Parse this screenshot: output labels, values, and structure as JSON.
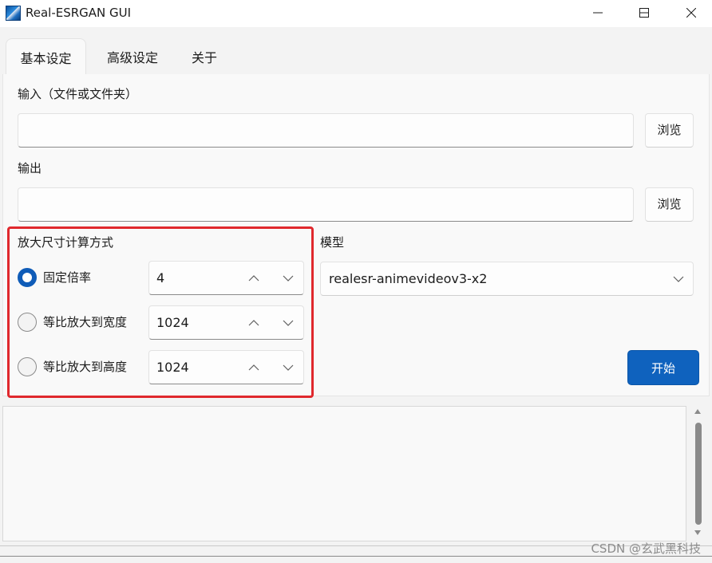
{
  "window": {
    "title": "Real-ESRGAN GUI",
    "controls": [
      "minimize",
      "maximize",
      "close"
    ]
  },
  "tabs": [
    {
      "label": "基本设定",
      "active": true
    },
    {
      "label": "高级设定",
      "active": false
    },
    {
      "label": "关于",
      "active": false
    }
  ],
  "input": {
    "label": "输入（文件或文件夹）",
    "value": "",
    "browse_label": "浏览"
  },
  "output": {
    "label": "输出",
    "value": "",
    "browse_label": "浏览"
  },
  "scale": {
    "label": "放大尺寸计算方式",
    "options": [
      {
        "label": "固定倍率",
        "selected": true,
        "value": "4"
      },
      {
        "label": "等比放大到宽度",
        "selected": false,
        "value": "1024"
      },
      {
        "label": "等比放大到高度",
        "selected": false,
        "value": "1024"
      }
    ]
  },
  "model": {
    "label": "模型",
    "selected": "realesr-animevideov3-x2"
  },
  "start_label": "开始",
  "log": {
    "content": ""
  },
  "watermark": "CSDN @玄武黑科技",
  "colors": {
    "accent": "#0f62be",
    "highlight": "#e0282d",
    "radio_on": "#0f5cb8"
  }
}
